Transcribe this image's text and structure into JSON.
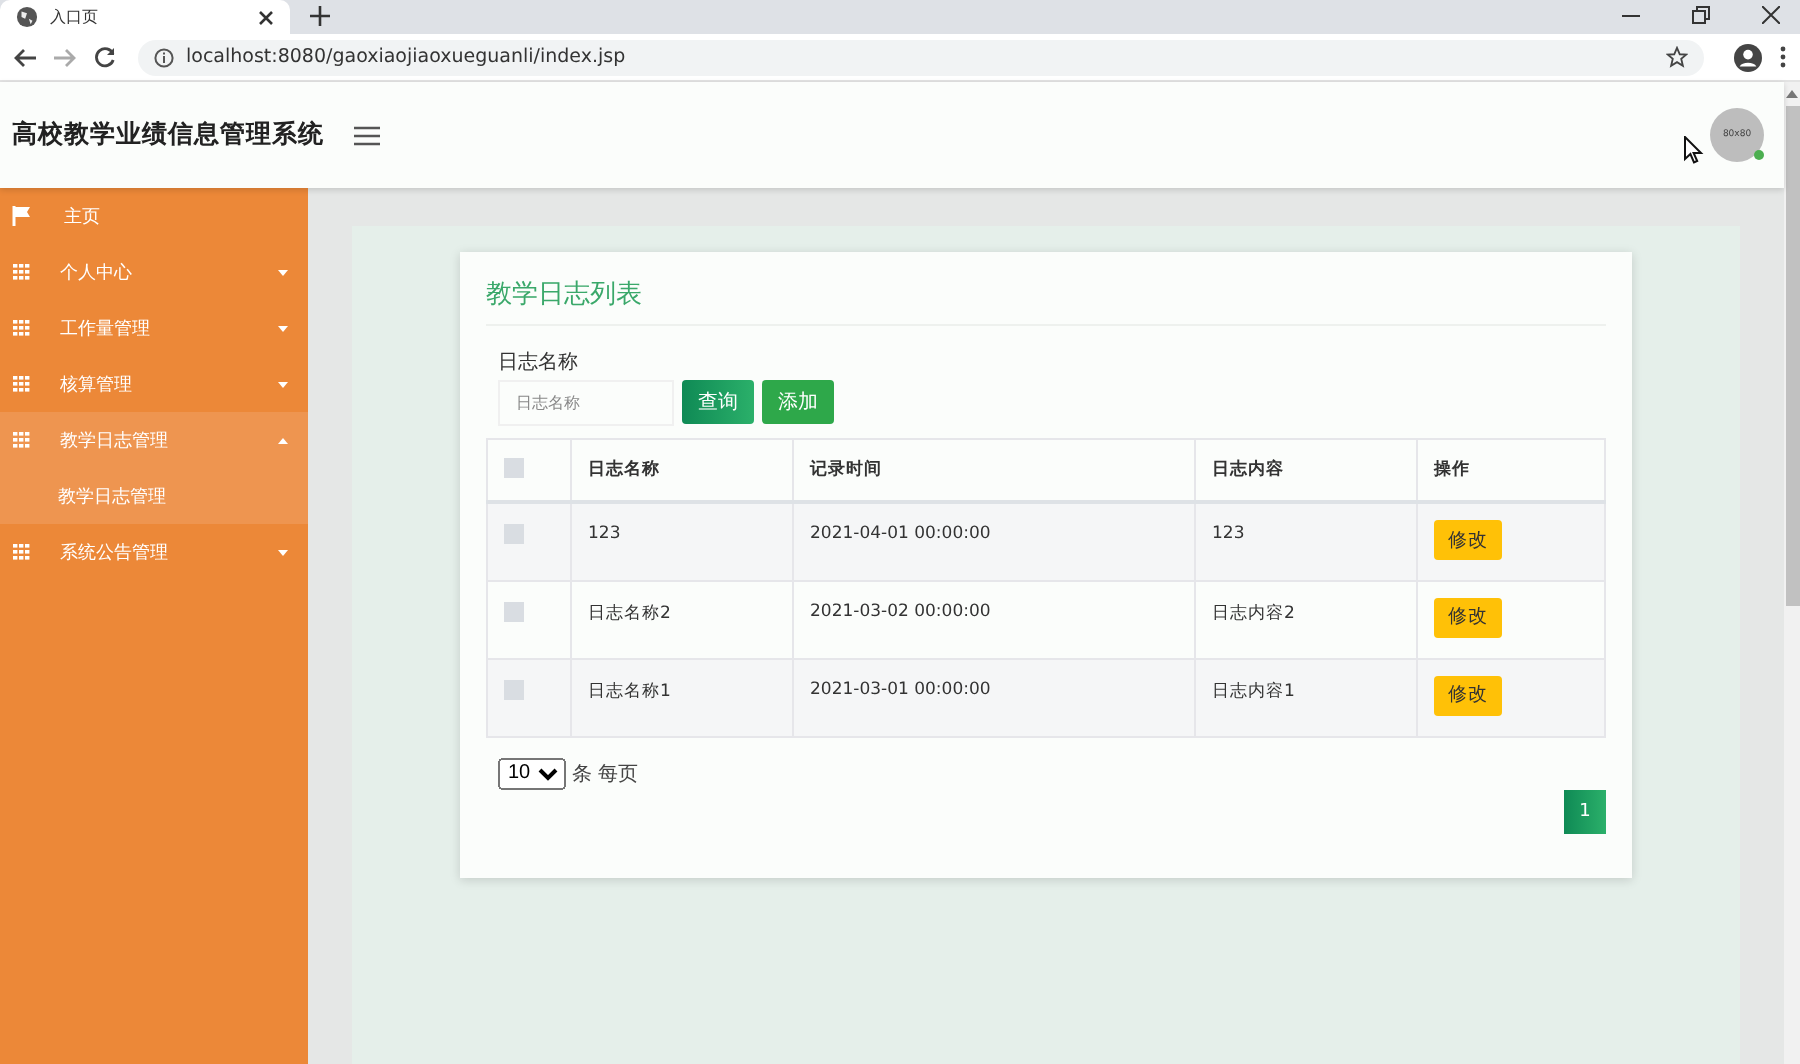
{
  "browser": {
    "tab_title": "入口页",
    "url": "localhost:8080/gaoxiaojiaoxueguanli/index.jsp"
  },
  "header": {
    "title": "高校教学业绩信息管理系统",
    "avatar_text": "80x80"
  },
  "sidebar": {
    "items": [
      {
        "label": "主页",
        "kind": "home"
      },
      {
        "label": "个人中心",
        "kind": "menu",
        "expanded": false
      },
      {
        "label": "工作量管理",
        "kind": "menu",
        "expanded": false
      },
      {
        "label": "核算管理",
        "kind": "menu",
        "expanded": false
      },
      {
        "label": "教学日志管理",
        "kind": "menu",
        "expanded": true,
        "children": [
          {
            "label": "教学日志管理"
          }
        ]
      },
      {
        "label": "系统公告管理",
        "kind": "menu",
        "expanded": false
      }
    ]
  },
  "card": {
    "title": "教学日志列表",
    "search_label": "日志名称",
    "search_placeholder": "日志名称",
    "buttons": [
      "查询",
      "添加"
    ]
  },
  "table": {
    "columns": [
      "日志名称",
      "记录时间",
      "日志内容",
      "操作"
    ],
    "header_checked": false,
    "rows": [
      {
        "checked": false,
        "cells": [
          "123",
          "2021-04-01 00:00:00",
          "123"
        ],
        "action": "修改"
      },
      {
        "checked": false,
        "cells": [
          "日志名称2",
          "2021-03-02 00:00:00",
          "日志内容2"
        ],
        "action": "修改"
      },
      {
        "checked": false,
        "cells": [
          "日志名称1",
          "2021-03-01 00:00:00",
          "日志内容1"
        ],
        "action": "修改"
      }
    ]
  },
  "pagination": {
    "page_size": "10",
    "page_size_label": "条 每页",
    "pages": [
      {
        "label": "1",
        "selected": true
      }
    ]
  }
}
